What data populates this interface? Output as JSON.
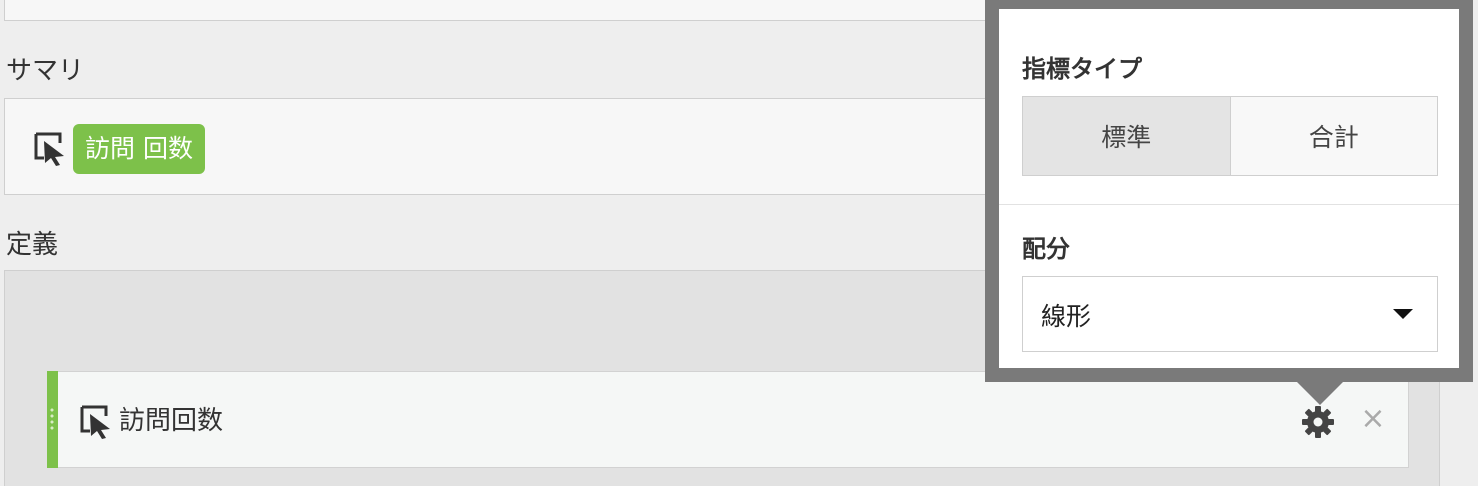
{
  "summary": {
    "label": "サマリ",
    "metric_pill": "訪問 回数",
    "icon": "cursor-select-icon"
  },
  "definition": {
    "label": "定義",
    "row": {
      "label": "訪問回数",
      "icon": "cursor-select-icon",
      "settings_icon": "gear-icon",
      "remove_icon": "close-icon",
      "remove_glyph": "×"
    }
  },
  "popover": {
    "metric_type_heading": "指標タイプ",
    "metric_type_options": [
      "標準",
      "合計"
    ],
    "metric_type_selected": "標準",
    "attribution_heading": "配分",
    "attribution_value": "線形"
  },
  "colors": {
    "accent_green": "#7dc14a",
    "popover_frame": "#7a7a7a"
  }
}
